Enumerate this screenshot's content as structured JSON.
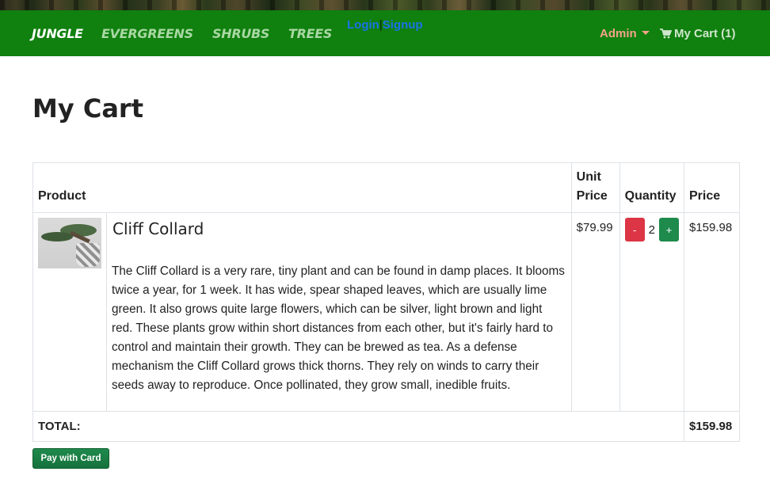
{
  "navbar": {
    "brand": "JUNGLE",
    "links": [
      "EVERGREENS",
      "SHRUBS",
      "TREES"
    ],
    "login": "Login",
    "auth_separator": "|",
    "signup": "Signup",
    "admin": "Admin",
    "cart": "My Cart (1)"
  },
  "page": {
    "title": "My Cart"
  },
  "table": {
    "headers": {
      "product": "Product",
      "unit_price": "Unit Price",
      "quantity": "Quantity",
      "price": "Price"
    },
    "items": [
      {
        "name": "Cliff Collard",
        "description": "The Cliff Collard is a very rare, tiny plant and can be found in damp places. It blooms twice a year, for 1 week. It has wide, spear shaped leaves, which are usually lime green. It also grows quite large flowers, which can be silver, light brown and light red. These plants grow within short distances from each other, but it's fairly hard to control and maintain their growth. They can be brewed as tea. As a defense mechanism the Cliff Collard grows thick thorns. They rely on winds to carry their seeds away to reproduce. Once pollinated, they grow small, inedible fruits.",
        "unit_price": "$79.99",
        "quantity": "2",
        "minus_label": "-",
        "plus_label": "+",
        "price": "$159.98"
      }
    ],
    "total_label": "TOTAL:",
    "total_value": "$159.98"
  },
  "actions": {
    "pay_label": "Pay with Card"
  },
  "colors": {
    "navbar_bg": "#10800f",
    "brand": "#ffffff",
    "nav_link": "#a9d7a3",
    "auth_link": "#1a73e8",
    "admin": "#f2a38a",
    "minus_button": "#dc3545",
    "plus_button": "#1e8a4c"
  },
  "icons": {
    "cart": "shopping-cart-icon",
    "dropdown": "caret-down-icon"
  }
}
